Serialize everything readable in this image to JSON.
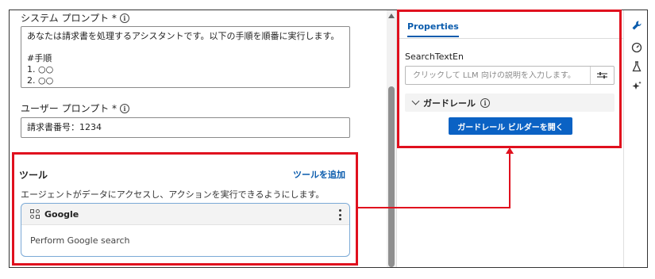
{
  "system_prompt": {
    "label": "システム プロンプト *",
    "lines": [
      "あなたは請求書を処理するアシスタントです。以下の手順を順番に実行します。",
      "",
      "#手順",
      "1. ○○",
      "2. ○○"
    ]
  },
  "user_prompt": {
    "label": "ユーザー プロンプト *",
    "value": "請求書番号：1234"
  },
  "tools": {
    "title": "ツール",
    "add_label": "ツールを追加",
    "description": "エージェントがデータにアクセスし、アクションを実行できるようにします。",
    "items": [
      {
        "name": "Google",
        "description": "Perform Google search"
      }
    ]
  },
  "properties": {
    "tab_label": "Properties",
    "field_label": "SearchTextEn",
    "llm_placeholder": "クリックして LLM 向けの説明を入力します。",
    "guardrail_label": "ガードレール",
    "guardrail_button": "ガードレール ビルダーを開く"
  },
  "rail_icons": [
    "wrench-icon",
    "gauge-icon",
    "flask-icon",
    "sparkle-icon"
  ],
  "colors": {
    "accent": "#0b5cad",
    "button": "#0b62c4",
    "highlight": "#e0101e"
  }
}
